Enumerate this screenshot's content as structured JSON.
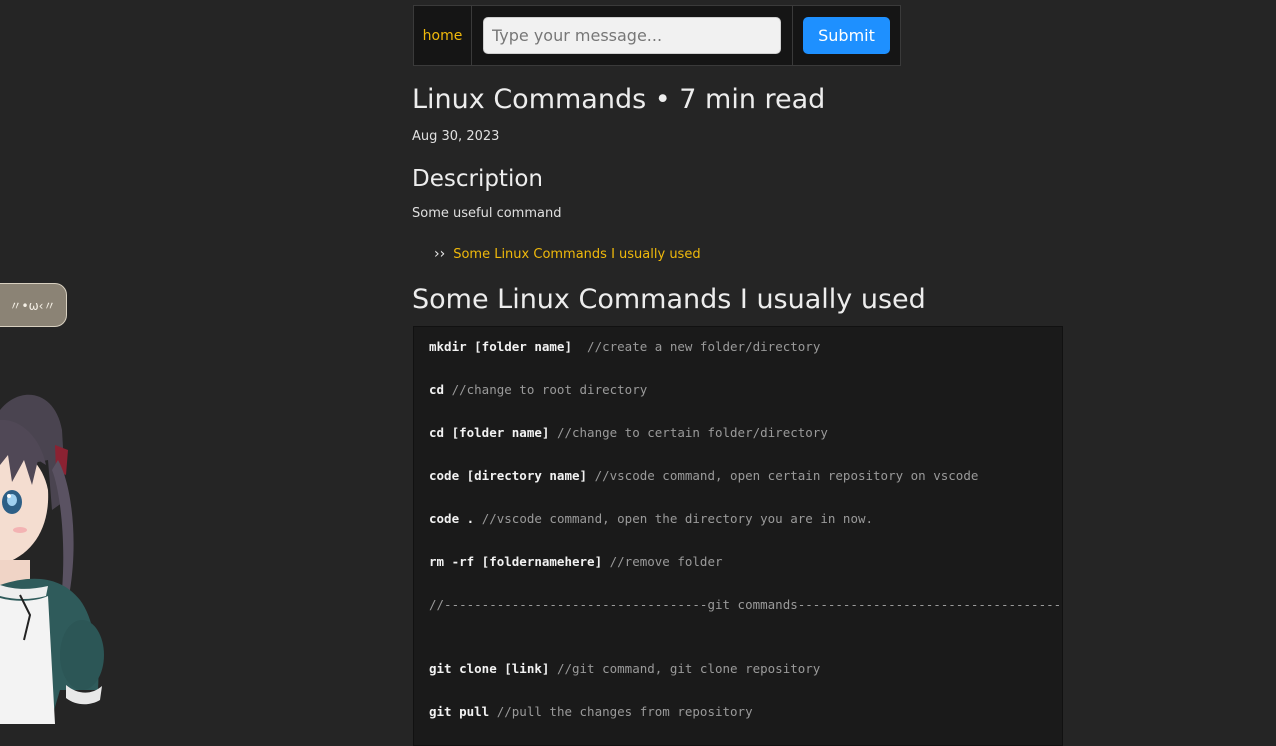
{
  "navbar": {
    "home_label": "home",
    "message_placeholder": "Type your message...",
    "submit_label": "Submit"
  },
  "post": {
    "title": "Linux Commands • 7 min read",
    "date": "Aug 30, 2023",
    "description_heading": "Description",
    "description_text": "Some useful command",
    "toc_bullet": "››",
    "toc": [
      {
        "label": "Some Linux Commands I usually used"
      }
    ],
    "section_heading": "Some Linux Commands I usually used"
  },
  "code": {
    "lines": [
      {
        "cmd": "mkdir [folder name]  ",
        "comment": "//create a new folder/directory"
      },
      {
        "cmd": "cd ",
        "comment": "//change to root directory"
      },
      {
        "cmd": "cd [folder name] ",
        "comment": "//change to certain folder/directory"
      },
      {
        "cmd": "code [directory name] ",
        "comment": "//vscode command, open certain repository on vscode"
      },
      {
        "cmd": "code . ",
        "comment": "//vscode command, open the directory you are in now."
      },
      {
        "cmd": "rm -rf [foldernamehere] ",
        "comment": "//remove folder"
      },
      {
        "cmd": "",
        "comment": "//-----------------------------------git commands-----------------------------------"
      },
      {
        "cmd": "git clone [link] ",
        "comment": "//git command, git clone repository"
      },
      {
        "cmd": "git pull ",
        "comment": "//pull the changes from repository"
      }
    ]
  },
  "widget": {
    "emote_text": "〃•ω‹〃",
    "mascot_icon": "anime-girl-mascot"
  },
  "colors": {
    "background": "#252525",
    "accent_link": "#f0b90b",
    "submit_button": "#1e90ff",
    "code_background": "#1a1a1a"
  }
}
